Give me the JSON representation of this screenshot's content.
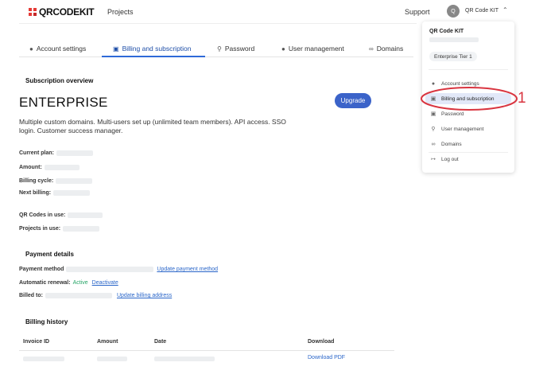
{
  "brand": {
    "name": "QRCODEKIT",
    "accent_color": "#e53935"
  },
  "nav": {
    "projects_label": "Projects",
    "support_label": "Support"
  },
  "user": {
    "avatar_initial": "Q",
    "name": "QR Code KIT",
    "chevron_icon": "chevron-up-icon"
  },
  "tabs": [
    {
      "label": "Account settings",
      "icon": "user-icon"
    },
    {
      "label": "Billing and subscription",
      "icon": "credit-card-icon",
      "active": true
    },
    {
      "label": "Password",
      "icon": "key-icon"
    },
    {
      "label": "User management",
      "icon": "user-icon"
    },
    {
      "label": "Domains",
      "icon": "link-icon"
    }
  ],
  "subscription": {
    "heading": "Subscription overview",
    "plan_name": "ENTERPRISE",
    "description": "Multiple custom domains. Multi-users set up (unlimited team members). API access. SSO login. Customer success manager.",
    "upgrade_label": "Upgrade",
    "fields": {
      "current_plan": "Current plan:",
      "amount": "Amount:",
      "billing_cycle": "Billing cycle:",
      "next_billing": "Next billing:",
      "qr_codes_in_use": "QR Codes in use:",
      "projects_in_use": "Projects in use:"
    }
  },
  "payment": {
    "heading": "Payment details",
    "method_label": "Payment method",
    "update_method_link": "Update payment method",
    "renewal_label": "Automatic renewal:",
    "renewal_status": "Active",
    "deactivate_link": "Deactivate",
    "billed_to_label": "Billed to:",
    "update_address_link": "Update billing address"
  },
  "billing_history": {
    "heading": "Billing history",
    "columns": [
      "Invoice ID",
      "Amount",
      "Date",
      "Download"
    ],
    "download_link": "Download PDF"
  },
  "dropdown": {
    "name": "QR Code KIT",
    "tier": "Enterprise Tier 1",
    "items": [
      {
        "label": "Account settings",
        "icon": "user-icon"
      },
      {
        "label": "Billing and subscription",
        "icon": "credit-card-icon",
        "selected": true
      },
      {
        "label": "Password",
        "icon": "lock-icon"
      },
      {
        "label": "User management",
        "icon": "key-icon"
      },
      {
        "label": "Domains",
        "icon": "link-icon"
      },
      {
        "label": "Log out",
        "icon": "logout-icon"
      }
    ]
  },
  "annotation": {
    "number": "1",
    "color": "#d93540"
  }
}
